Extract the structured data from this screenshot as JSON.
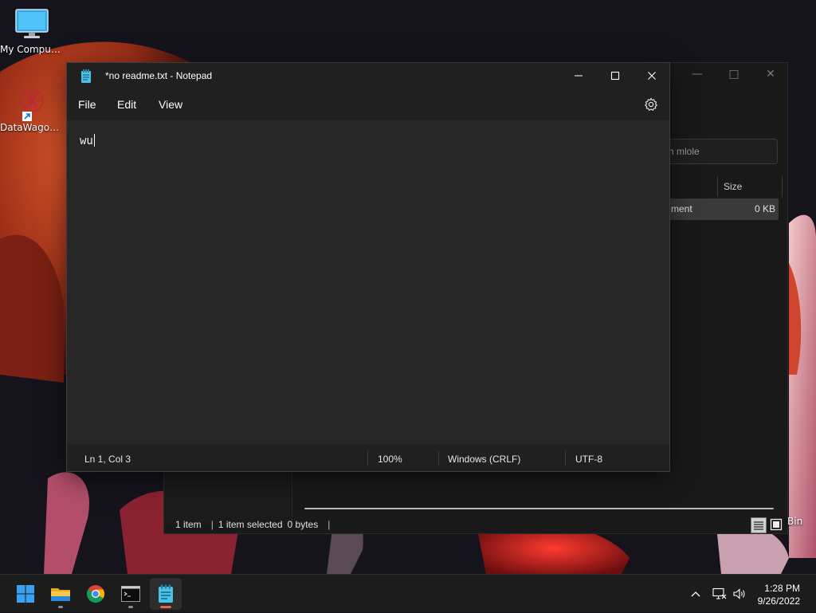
{
  "desktop": {
    "icons": [
      {
        "label": "My Computer"
      },
      {
        "label": "DataWagon..."
      }
    ],
    "recycle_bin_partial": "Bin"
  },
  "explorer": {
    "search_placeholder_visible": "ch mlole",
    "column_size": "Size",
    "row": {
      "type_partial": "ment",
      "size": "0 KB"
    },
    "status": {
      "items": "1 item",
      "selected": "1 item selected",
      "size": "0 bytes"
    }
  },
  "notepad": {
    "title": "*no readme.txt - Notepad",
    "menu": {
      "file": "File",
      "edit": "Edit",
      "view": "View"
    },
    "content": "wu",
    "status": {
      "position": "Ln 1, Col 3",
      "zoom": "100%",
      "line_ending": "Windows (CRLF)",
      "encoding": "UTF-8"
    }
  },
  "taskbar": {
    "apps": [
      {
        "icon": "windows-start-icon"
      },
      {
        "icon": "file-explorer-icon",
        "running": true
      },
      {
        "icon": "chrome-icon"
      },
      {
        "icon": "terminal-icon",
        "running": true
      },
      {
        "icon": "notepad-icon",
        "running": true,
        "active": true
      }
    ],
    "clock": {
      "time": "1:28 PM",
      "date": "9/26/2022"
    }
  },
  "colors": {
    "accent": "#e5674a",
    "window_bg": "#272727",
    "titlebar_bg": "#202020",
    "taskbar_bg": "#1c1c1c"
  }
}
